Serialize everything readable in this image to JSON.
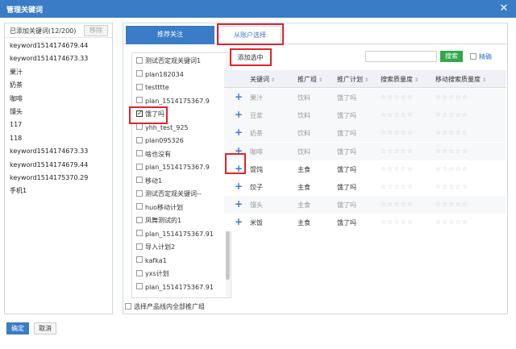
{
  "dialog": {
    "title": "管理关键词",
    "close_icon": "close-icon"
  },
  "left": {
    "count_label": "已添加关键词(12/200)",
    "remove_label": "移除",
    "keywords": [
      "keyword1514174679.44",
      "keyword1514174673.33",
      "果汁",
      "奶茶",
      "咖啡",
      "馒头",
      "117",
      "118",
      "keyword1514174673.33",
      "keyword1514174679.44",
      "keyword1514175370.29",
      "手机1"
    ]
  },
  "tabs": {
    "recommended": "推荐关注",
    "from_account": "从账户选择"
  },
  "plans": [
    {
      "label": "测试否定观关键词1",
      "checked": false
    },
    {
      "label": "plan182034",
      "checked": false
    },
    {
      "label": "testttte",
      "checked": false
    },
    {
      "label": "plan_1514175367.9",
      "checked": false
    },
    {
      "label": "饿了吗",
      "checked": true
    },
    {
      "label": "yhh_test_925",
      "checked": false
    },
    {
      "label": "plan095326",
      "checked": false
    },
    {
      "label": "啥也没有",
      "checked": false
    },
    {
      "label": "plan_1514175367.9",
      "checked": false
    },
    {
      "label": "移动1",
      "checked": false
    },
    {
      "label": "测试否定观关键词--",
      "checked": false
    },
    {
      "label": "huo移动计划",
      "checked": false
    },
    {
      "label": "凤舞测试的1",
      "checked": false
    },
    {
      "label": "plan_1514175367.91",
      "checked": false
    },
    {
      "label": "导入计划2",
      "checked": false
    },
    {
      "label": "kafka1",
      "checked": false
    },
    {
      "label": "yxs计划",
      "checked": false
    },
    {
      "label": "plan_1514175367.91",
      "checked": false
    }
  ],
  "all_groups_label": "选择产品线内全部推广组",
  "toolbar": {
    "add_selected": "添加选中",
    "search_label": "搜索",
    "exact_label": "精确",
    "search_value": ""
  },
  "table": {
    "headers": [
      "关键词",
      "推广组",
      "推广计划",
      "搜索质量度",
      "移动搜索质量度"
    ],
    "rows": [
      {
        "keyword": "果汁",
        "group": "饮料",
        "plan": "饿了吗",
        "added": true
      },
      {
        "keyword": "豆浆",
        "group": "饮料",
        "plan": "饿了吗",
        "added": true
      },
      {
        "keyword": "奶茶",
        "group": "饮料",
        "plan": "饿了吗",
        "added": true
      },
      {
        "keyword": "咖啡",
        "group": "饮料",
        "plan": "饿了吗",
        "added": true
      },
      {
        "keyword": "馄饨",
        "group": "主食",
        "plan": "饿了吗",
        "added": false
      },
      {
        "keyword": "饺子",
        "group": "主食",
        "plan": "饿了吗",
        "added": false
      },
      {
        "keyword": "馒头",
        "group": "主食",
        "plan": "饿了吗",
        "added": true
      },
      {
        "keyword": "米饭",
        "group": "主食",
        "plan": "饿了吗",
        "added": false
      }
    ],
    "stars_text": "☆☆☆☆☆"
  },
  "footer": {
    "ok_label": "确定",
    "cancel_label": "取消"
  },
  "colors": {
    "accent": "#3a7cc5",
    "search_green": "#30a94a",
    "highlight_red": "#e0242b"
  }
}
